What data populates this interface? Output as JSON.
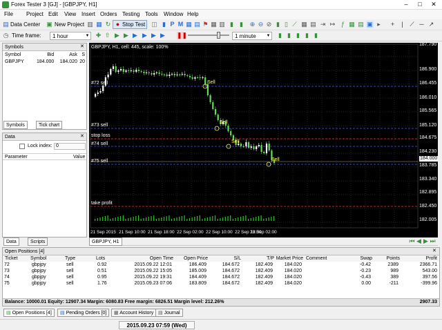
{
  "window": {
    "title": "Forex Tester 3  [GJ] - [GBPJPY, H1]",
    "min": "–",
    "max": "□",
    "close": "✕"
  },
  "menu": [
    "File",
    "Project",
    "Edit",
    "View",
    "Insert",
    "Orders",
    "Testing",
    "Tools",
    "Window",
    "Help"
  ],
  "toolbar": {
    "data_center": "Data Center",
    "new_project": "New Project",
    "stop_test": "Stop Test",
    "timeframe_label": "Time frame:",
    "timeframe_value": "1 hour",
    "speed_value": "1 minute"
  },
  "symbols_panel": {
    "title": "Symbols",
    "headers": [
      "Symbol",
      "Bid",
      "Ask",
      "S"
    ],
    "rows": [
      {
        "symbol": "GBPJPY",
        "bid": "184.000",
        "ask": "184.020",
        "s": "20"
      }
    ],
    "tabs": [
      "Symbols",
      "Tick chart"
    ]
  },
  "data_panel": {
    "title": "Data",
    "lock_label": "Lock index:",
    "lock_value": "0",
    "headers": [
      "Parameter",
      "Value"
    ],
    "tabs": [
      "Data",
      "Scripts"
    ]
  },
  "chart": {
    "info": "GBPJPY, H1, cell: 445, scale: 100%",
    "tab": "GBPJPY, H1",
    "price_labels": [
      "187.790",
      "186.900",
      "186.455",
      "186.010",
      "185.565",
      "185.120",
      "184.675",
      "184.230",
      "184.000",
      "183.785",
      "183.340",
      "182.895",
      "182.450",
      "182.005"
    ],
    "current_price": "184.000",
    "date_labels": [
      "21 Sep 2015",
      "21 Sep 10:00",
      "21 Sep 18:00",
      "22 Sep 02:00",
      "22 Sep 10:00",
      "22 Sep 18:00",
      "23 Sep 02:00"
    ],
    "order_labels": [
      "#72 sell",
      "#73 sell",
      "stop loss",
      "#74 sell",
      "#75 sell",
      "take profit"
    ],
    "sell_marks": [
      "Sell",
      "Sell",
      "Sell",
      "Sell"
    ],
    "colors": {
      "bull": "#ffffff",
      "bear": "#66dd55",
      "stop_line": "#cc2222",
      "order_line": "#3344cc",
      "volume": "#22cc22"
    }
  },
  "open_positions": {
    "title": "Open Positions [4]",
    "headers": [
      "Ticket",
      "Symbol",
      "Type",
      "Lots",
      "Open Time",
      "Open Price",
      "S/L",
      "T/P",
      "Market Price",
      "Comment",
      "Swap",
      "Points",
      "Profit"
    ],
    "rows": [
      [
        "72",
        "gbpjpy",
        "sell",
        "0.92",
        "2015.09.22 12:01",
        "186.409",
        "184.672",
        "182.409",
        "184.020",
        "",
        "-0.42",
        "2389",
        "2366.71"
      ],
      [
        "73",
        "gbpjpy",
        "sell",
        "0.51",
        "2015.09.22 15:05",
        "185.009",
        "184.672",
        "182.409",
        "184.020",
        "",
        "-0.23",
        "989",
        "543.00"
      ],
      [
        "74",
        "gbpjpy",
        "sell",
        "0.95",
        "2015.09.22 19:31",
        "184.409",
        "184.672",
        "182.409",
        "184.020",
        "",
        "-0.43",
        "389",
        "397.56"
      ],
      [
        "75",
        "gbpjpy",
        "sell",
        "1.76",
        "2015.09.23 07:06",
        "183.809",
        "184.672",
        "182.409",
        "184.020",
        "",
        "0.00",
        "-211",
        "-399.96"
      ]
    ],
    "balance": "Balance: 10000.01 Equity: 12907.34 Margin: 6080.83 Free margin: 6826.51 Margin level: 212.26%",
    "total": "2907.33"
  },
  "bottom_tabs": [
    "Open Positions [4]",
    "Pending Orders [0]",
    "Account History",
    "Journal"
  ],
  "status": {
    "datetime": "2015.09.23 07:59 (Wed)"
  }
}
